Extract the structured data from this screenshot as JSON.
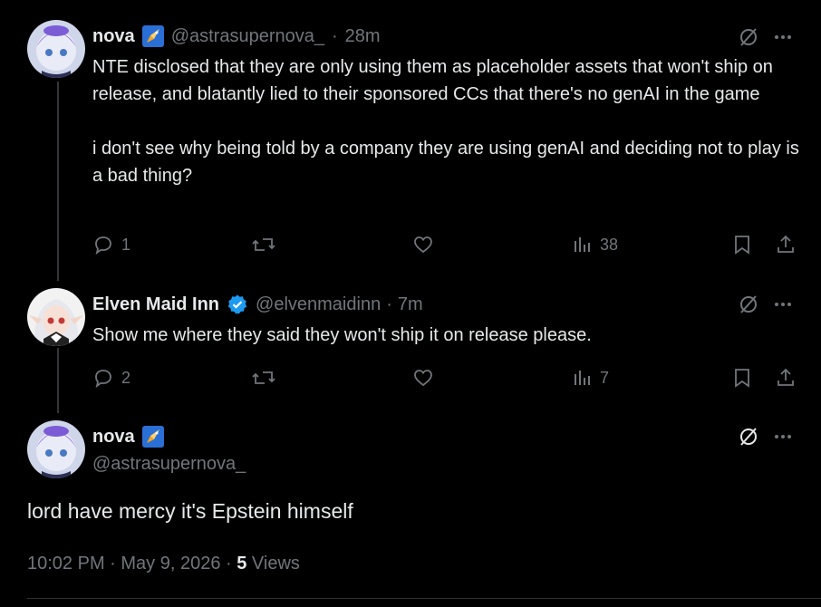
{
  "tweets": [
    {
      "name": "nova",
      "handle": "@astrasupernova_",
      "time": "28m",
      "text": "NTE disclosed that they are only using them as placeholder assets that won't ship on release, and blatantly lied to their sponsored CCs that there's no genAI in the game\n\ni don't see why being told by a company they are using genAI and deciding not to play is a bad thing?",
      "replies": "1",
      "retweets": "",
      "likes": "",
      "views": "38"
    },
    {
      "name": "Elven Maid Inn",
      "handle": "@elvenmaidinn",
      "time": "7m",
      "text": "Show me where they said they won't ship it on release  please.",
      "replies": "2",
      "retweets": "",
      "likes": "",
      "views": "7"
    }
  ],
  "main_tweet": {
    "name": "nova",
    "handle": "@astrasupernova_",
    "text": "lord have mercy it's Epstein himself",
    "timestamp": "10:02 PM · May 9, 2026",
    "separator": " · ",
    "views_count": "5",
    "views_label": "Views"
  },
  "colors": {
    "background": "#000000",
    "text": "#e7e9ea",
    "secondary": "#71767b",
    "verified": "#1d9bf0",
    "badge": "#2a6fd6"
  },
  "icons": [
    "grok-icon",
    "more-icon",
    "reply-icon",
    "retweet-icon",
    "like-icon",
    "views-icon",
    "bookmark-icon",
    "share-icon",
    "verified-icon"
  ]
}
